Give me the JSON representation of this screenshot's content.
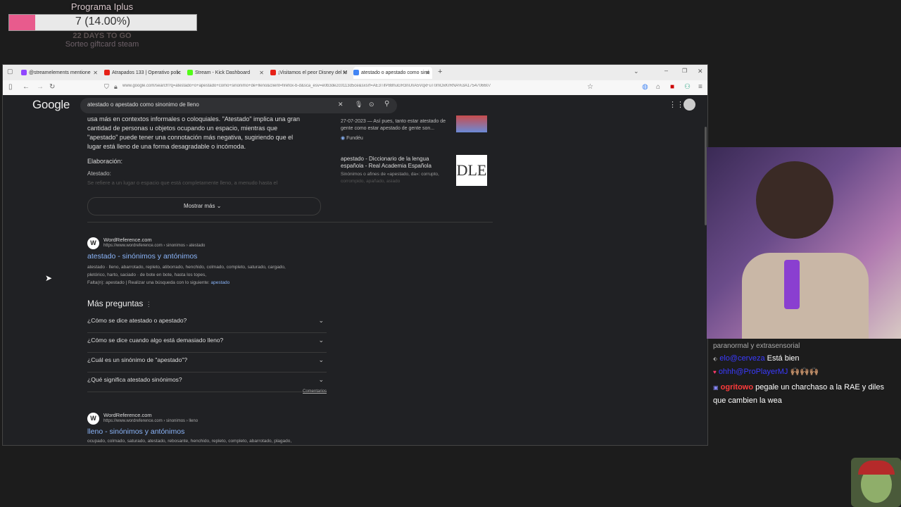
{
  "overlay": {
    "title": "Programa Iplus",
    "goal_text": "7 (14.00%)",
    "goal_progress": 14,
    "days": "22 DAYS TO GO",
    "raffle": "Sorteo giftcard steam"
  },
  "browser": {
    "tabs": [
      {
        "label": "@streamelements mentione",
        "color": "#9147ff"
      },
      {
        "label": "Atrapados 133 | Operativo polic",
        "color": "#e62117"
      },
      {
        "label": "Stream - Kick Dashboard",
        "color": "#53fc18"
      },
      {
        "label": "¡Visitamos el peor Disney del M",
        "color": "#e62117"
      },
      {
        "label": "atestado o apestado como sinó",
        "color": "#4285f4"
      }
    ],
    "url": "www.google.com/search?q=atestado+o+apestado+como+sinonimo+de+lleno&client=firefox-b-d&sca_esv=e0b3de2c0113d5ce&sxsrf=AE3TifP88huGR3nUnA5VqxFuT0mOxKrRNA%3A1754706607"
  },
  "google": {
    "logo": "Google",
    "query": "atestado o apestado como sinonimo de lleno"
  },
  "snippet": {
    "line1": "usa más en contextos informales o coloquiales. \"Atestado\" implica una gran",
    "line2": "cantidad de personas u objetos ocupando un espacio, mientras que",
    "line3": "\"apestado\" puede tener una connotación más negativa, sugiriendo que el",
    "line4": "lugar está lleno de una forma desagradable o incómoda.",
    "elab": "Elaboración:",
    "atestado": "Atestado:",
    "faded": "Se refiere a un lugar o espacio que está completamente lleno, a menudo hasta el",
    "show_more": "Mostrar más"
  },
  "side": {
    "r1_date": "27-07-2023 — Así pues, tanto estar atestado de",
    "r1_line2": "gente como estar apestado de gente son...",
    "r1_source": "Fundéu",
    "r2_title1": "apestado - Diccionario de la lengua",
    "r2_title2": "española - Real Academia Española",
    "r2_desc1": "Sinónimos o afines de «apestado, da»: corrupto,",
    "r2_desc2": "corrompido, apañado, asiado"
  },
  "result1": {
    "site": "WordReference.com",
    "url": "https://www.wordreference.com › sinonimos › atestado",
    "title": "atestado - sinónimos y antónimos",
    "desc1": "atestado · lleno, abarrotado, repleto, atiborrado, henchido, colmado, completo, saturado, cargado,",
    "desc2": "pletórico, harto, saciado · de bote en bote, hasta los topes,",
    "missing": "Falta(n): apestado | Realizar una búsqueda con lo siguiente:",
    "missing_link": "apestado"
  },
  "paa": {
    "title": "Más preguntas",
    "q1": "¿Cómo se dice atestado o apestado?",
    "q2": "¿Cómo se dice cuando algo está demasiado lleno?",
    "q3": "¿Cuál es un sinónimo de \"apestado\"?",
    "q4": "¿Qué significa atestado sinónimos?",
    "feedback": "Comentarios"
  },
  "result2": {
    "site": "WordReference.com",
    "url": "https://www.wordreference.com › sinonimos › lleno",
    "title": "lleno - sinónimos y antónimos",
    "desc": "ocupado, colmado, saturado, atestado, rebosante, henchido, repleto, completo, abarrotado, plagado,"
  },
  "chat": {
    "top": "paranormal y extrasensorial",
    "m1_user": "elo@cerveza",
    "m1_text": "Está bien",
    "m2_user": "ohhh@ProPlayerMJ",
    "m2_text": "🙌🏽🙌🏽🙌🏽",
    "m3_user": "ogritowo",
    "m3_text": "pegale un charchaso a la RAE y diles",
    "m3_text2": "que cambien la wea"
  },
  "colors": {
    "accent_pink": "#e85b8d",
    "google_link": "#8ab4f8",
    "chat_user_red": "#ff3b3b",
    "chat_user_blue": "#3a3aff"
  }
}
